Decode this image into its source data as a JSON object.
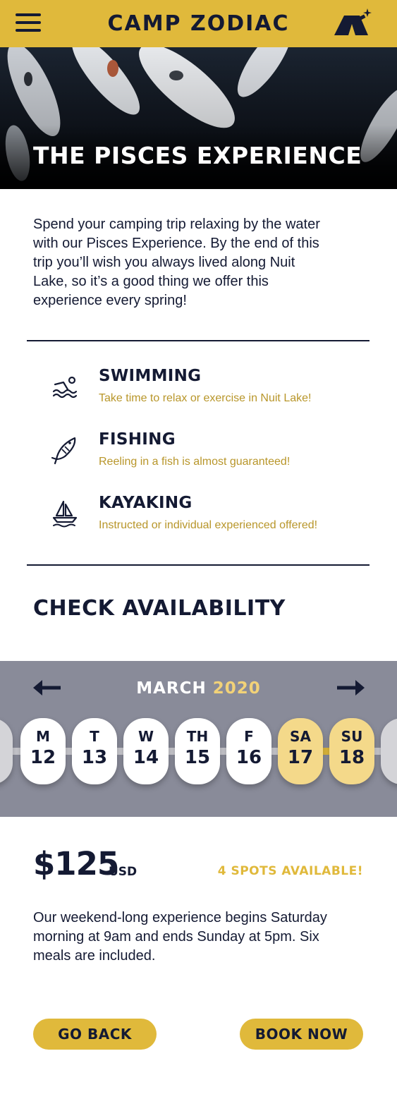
{
  "header": {
    "brand": "CAMP ZODIAC",
    "menu_icon": "hamburger-menu-icon",
    "logo_icon": "tent-telescope-icon"
  },
  "hero": {
    "title": "THE PISCES EXPERIENCE",
    "image": "koi-fish-photo"
  },
  "intro": "Spend your camping trip relaxing by the water with our Pisces Experience. By the end of this trip you’ll wish you always lived along Nuit Lake, so it’s a good thing we offer this experience every spring!",
  "activities": [
    {
      "name": "SWIMMING",
      "description": "Take time to relax or exercise in Nuit Lake!",
      "icon": "swimmer-icon"
    },
    {
      "name": "FISHING",
      "description": "Reeling in a fish is almost guaranteed!",
      "icon": "fish-icon"
    },
    {
      "name": "KAYAKING",
      "description": "Instructed or individual experienced offered!",
      "icon": "sailboat-icon"
    }
  ],
  "availability": {
    "title": "CHECK AVAILABILITY",
    "month": "MARCH",
    "year": "2020",
    "prev_icon": "arrow-left-icon",
    "next_icon": "arrow-right-icon",
    "days": [
      {
        "name": "M",
        "date": "12",
        "selected": false
      },
      {
        "name": "T",
        "date": "13",
        "selected": false
      },
      {
        "name": "W",
        "date": "14",
        "selected": false
      },
      {
        "name": "TH",
        "date": "15",
        "selected": false
      },
      {
        "name": "F",
        "date": "16",
        "selected": false
      },
      {
        "name": "SA",
        "date": "17",
        "selected": true
      },
      {
        "name": "SU",
        "date": "18",
        "selected": true
      }
    ]
  },
  "booking": {
    "price": "$125",
    "currency": "USD",
    "spots": "4 SPOTS AVAILABLE!",
    "details": "Our weekend-long experience begins Saturday morning at 9am and ends Sunday at 5pm. Six meals are included.",
    "back_label": "GO BACK",
    "book_label": "BOOK NOW"
  },
  "colors": {
    "accent": "#e0b93b",
    "navy": "#141a33",
    "calendar_bg": "#898b99",
    "selected_day": "#f4d98a"
  }
}
